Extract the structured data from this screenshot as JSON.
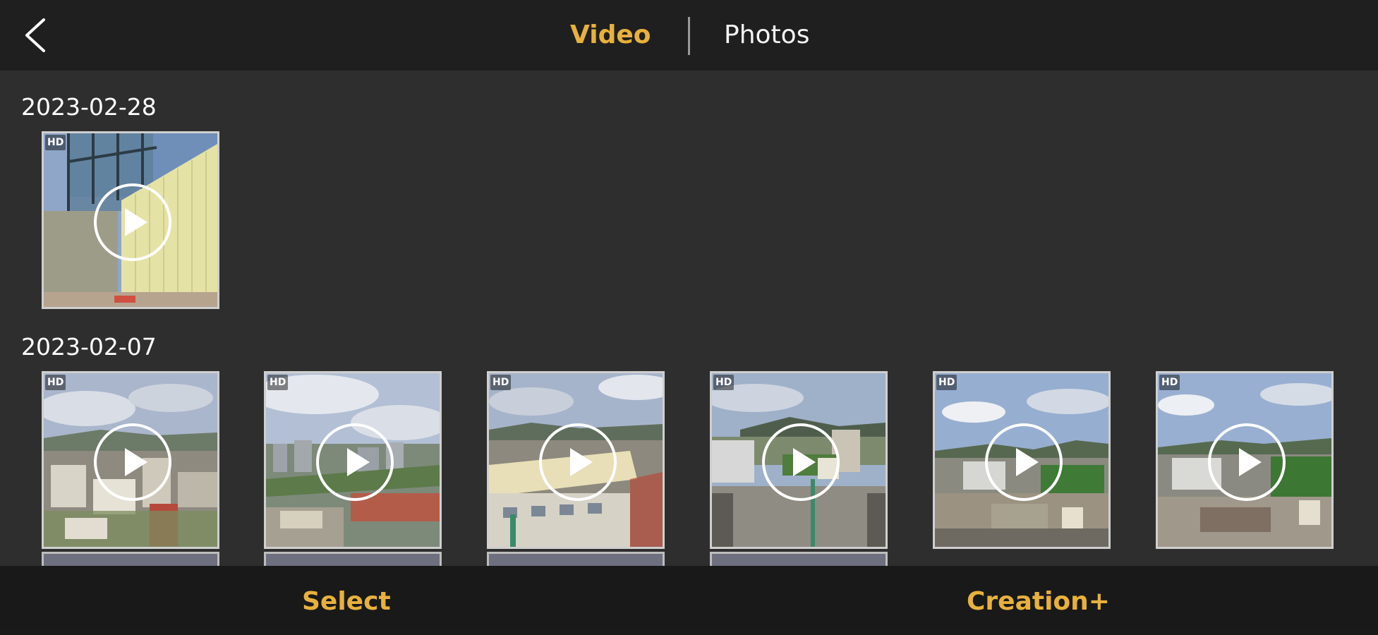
{
  "header": {
    "back_icon": "chevron-left-icon",
    "tabs": [
      {
        "label": "Video",
        "active": true
      },
      {
        "label": "Photos",
        "active": false
      }
    ],
    "accent_color": "#e8b13d"
  },
  "sections": [
    {
      "date": "2023-02-28",
      "items": [
        {
          "badge": "HD",
          "icon": "play-icon"
        }
      ]
    },
    {
      "date": "2023-02-07",
      "items": [
        {
          "badge": "HD",
          "icon": "play-icon"
        },
        {
          "badge": "HD",
          "icon": "play-icon"
        },
        {
          "badge": "HD",
          "icon": "play-icon"
        },
        {
          "badge": "HD",
          "icon": "play-icon"
        },
        {
          "badge": "HD",
          "icon": "play-icon"
        },
        {
          "badge": "HD",
          "icon": "play-icon"
        }
      ]
    }
  ],
  "bottom_bar": {
    "select_label": "Select",
    "creation_label": "Creation+"
  }
}
